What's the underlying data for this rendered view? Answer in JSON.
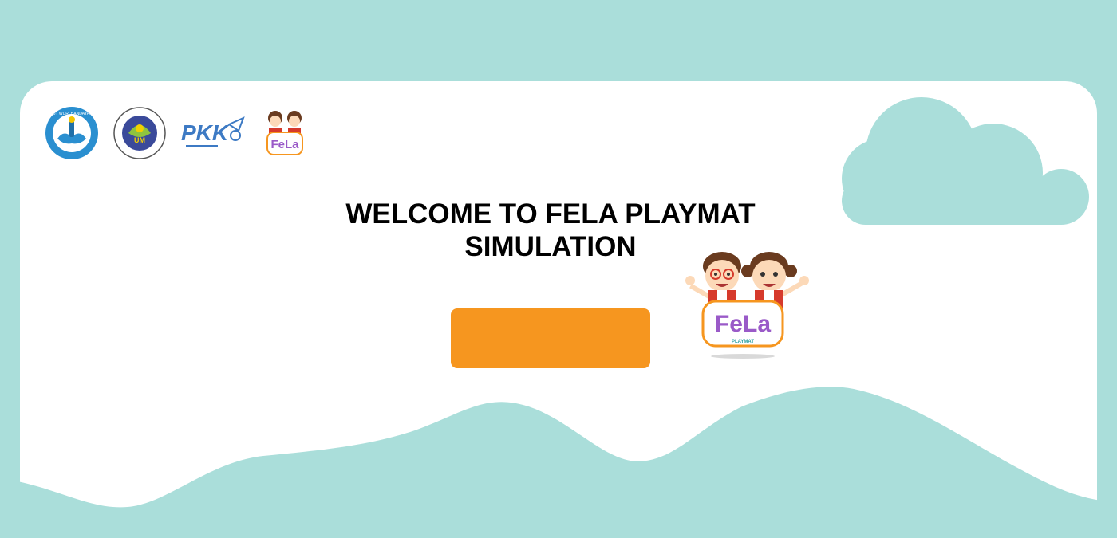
{
  "header": {
    "logos": [
      {
        "name": "tut-wuri-handayani-logo",
        "text": "TUT WURI HANDAYANI"
      },
      {
        "name": "universitas-negeri-malang-logo",
        "text": "UNIVERSITAS NEGERI MALANG",
        "badge": "UM"
      },
      {
        "name": "pkk-logo",
        "text": "PKK"
      },
      {
        "name": "fela-playmat-logo",
        "text": "FeLa"
      }
    ]
  },
  "main": {
    "title": "WELCOME TO FELA PLAYMAT SIMULATION",
    "start_button_label": "",
    "mascot": {
      "brand": "FeLa",
      "sub": "PLAYMAT"
    }
  },
  "colors": {
    "background": "#aadeda",
    "card": "#ffffff",
    "button": "#f6961f",
    "text": "#000000"
  }
}
